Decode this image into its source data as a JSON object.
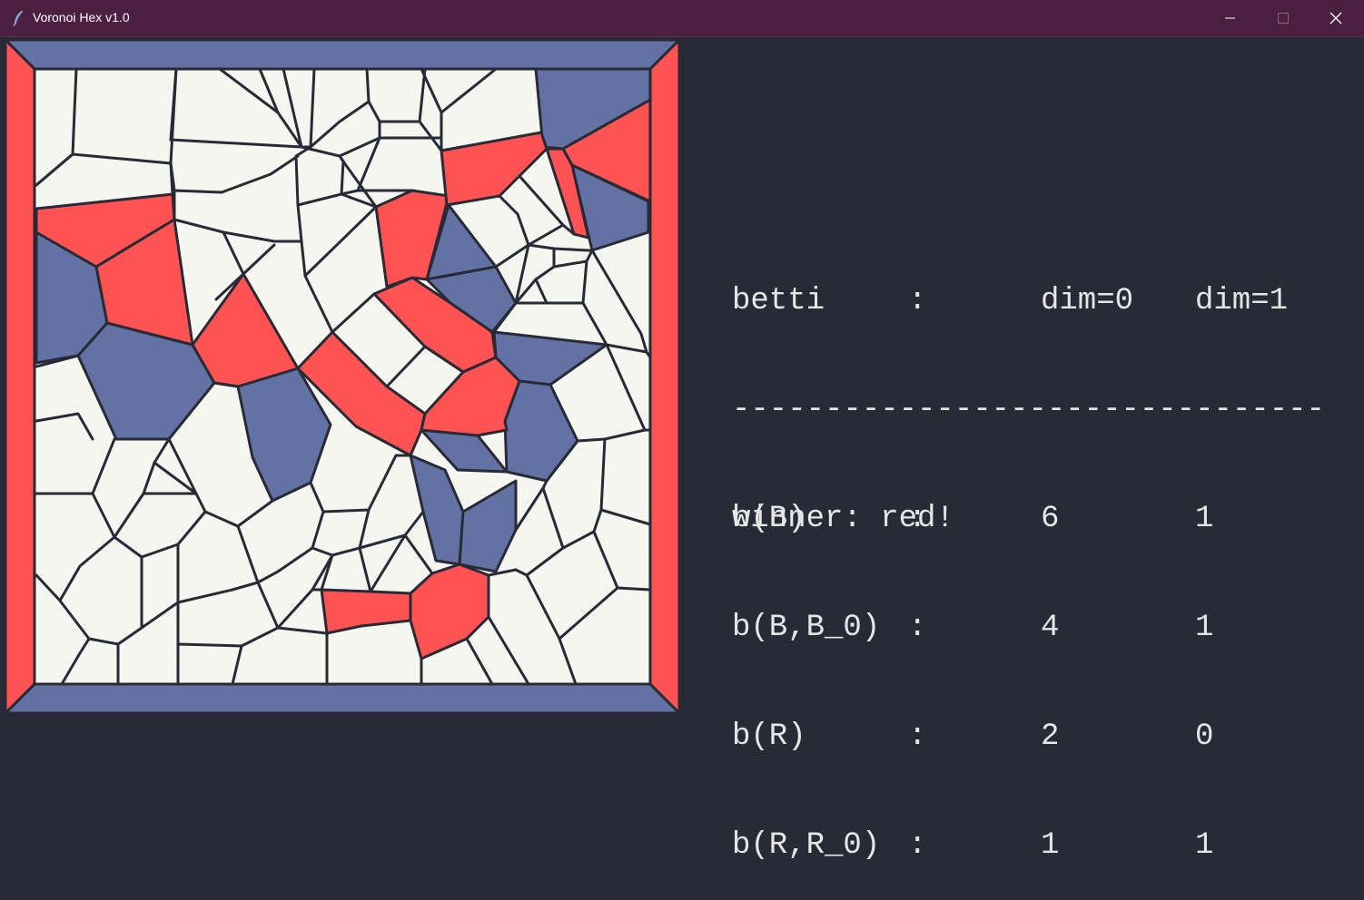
{
  "window": {
    "title": "Voronoi Hex v1.0",
    "icon": "feather-icon",
    "controls": [
      "minimize-icon",
      "maximize-icon",
      "close-icon"
    ]
  },
  "colors": {
    "red": "#ff5252",
    "blue": "#6272a4",
    "cell": "#f6f6f1",
    "edge": "#282a36",
    "background": "#282a36",
    "titlebar": "#4b1f3f"
  },
  "stats": {
    "header": [
      "betti",
      ":",
      "dim=0",
      "dim=1"
    ],
    "separator": "--------------------------------",
    "rows": [
      {
        "label": "b(B)",
        "sep": ":",
        "dim0": "6",
        "dim1": "1"
      },
      {
        "label": "b(B,B_0)",
        "sep": ":",
        "dim0": "4",
        "dim1": "1"
      },
      {
        "label": "b(R)",
        "sep": ":",
        "dim0": "2",
        "dim1": "0"
      },
      {
        "label": "b(R,R_0)",
        "sep": ":",
        "dim0": "1",
        "dim1": "1"
      }
    ],
    "winner": "winner: red!"
  }
}
